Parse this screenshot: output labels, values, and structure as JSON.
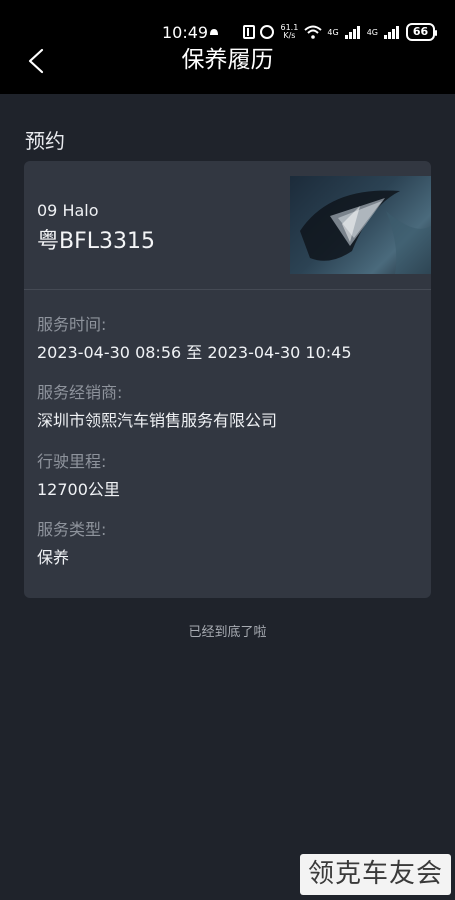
{
  "status_bar": {
    "time": "10:49",
    "speed_value": "61.1",
    "speed_unit": "K/s",
    "signal1": "4G",
    "signal2": "4G",
    "battery": "66"
  },
  "header": {
    "title": "保养履历"
  },
  "section": {
    "title": "预约"
  },
  "card": {
    "vehicle_model": "09 Halo",
    "plate": "粤BFL3315",
    "fields": [
      {
        "label": "服务时间:",
        "value": "2023-04-30 08:56 至 2023-04-30 10:45"
      },
      {
        "label": "服务经销商:",
        "value": "深圳市领熙汽车销售服务有限公司"
      },
      {
        "label": "行驶里程:",
        "value": "12700公里"
      },
      {
        "label": "服务类型:",
        "value": "保养"
      }
    ]
  },
  "footer": {
    "end_text": "已经到底了啦"
  },
  "watermark": {
    "text": "领克车友会"
  }
}
